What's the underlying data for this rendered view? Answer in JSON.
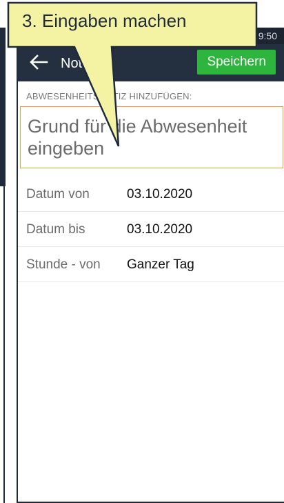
{
  "status": {
    "time": "9:50"
  },
  "appbar": {
    "title": "Notizier",
    "save_label": "Speichern"
  },
  "form": {
    "section_label": "ABWESENHEITSNOTIZ HINZUFÜGEN:",
    "note_placeholder": "Grund für die Abwesenheit eingeben",
    "rows": [
      {
        "label": "Datum von",
        "value": "03.10.2020"
      },
      {
        "label": "Datum bis",
        "value": "03.10.2020"
      },
      {
        "label": "Stunde - von",
        "value": "Ganzer Tag"
      }
    ]
  },
  "callout": {
    "text": "3. Eingaben machen",
    "fill": "#f3f3a3",
    "border": "#1f2a3a"
  },
  "colors": {
    "appbar": "#24303f",
    "accent_save": "#2db53d",
    "input_border": "#f0a030"
  }
}
